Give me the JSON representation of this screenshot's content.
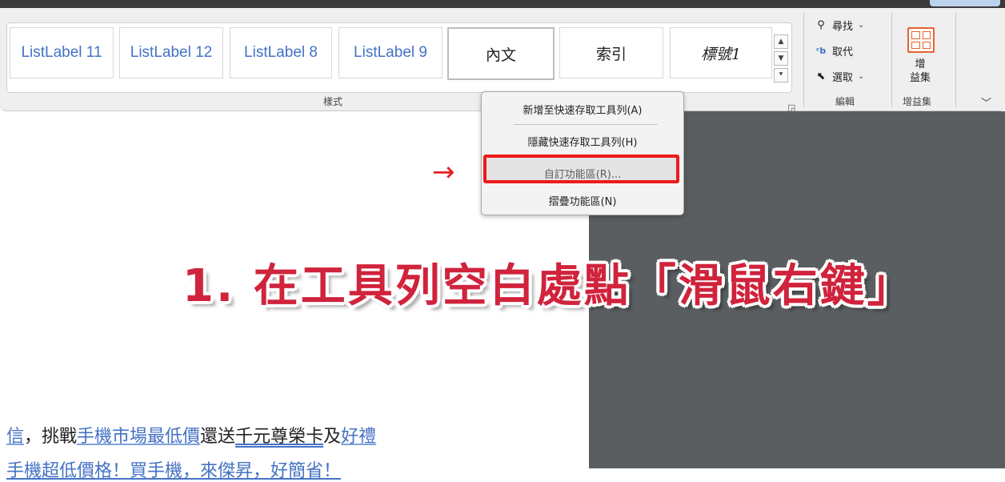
{
  "styles": {
    "items": [
      "ListLabel 11",
      "ListLabel 12",
      "ListLabel 8",
      "ListLabel 9",
      "內文",
      "索引",
      "標號1"
    ],
    "group_label": "樣式"
  },
  "editing": {
    "find": "尋找",
    "replace": "取代",
    "select": "選取",
    "group_label": "編輯"
  },
  "addins": {
    "button_label": "增\n益集",
    "group_label": "增益集"
  },
  "context_menu": {
    "items": [
      "新增至快速存取工具列(A)",
      "隱藏快速存取工具列(H)",
      "自訂功能區(R)...",
      "摺疊功能區(N)"
    ]
  },
  "annotation": {
    "caption": "1. 在工具列空白處點「滑鼠右鍵」",
    "arrow": "→",
    "highlight_color": "#ee1b1b"
  },
  "document": {
    "line1": {
      "a": "信",
      "b": "，挑戰",
      "c": "手機市場最低價",
      "d": "還送",
      "e": "千元尊榮卡",
      "f": "及",
      "g": "好禮"
    },
    "line2": "手機超低價格！買手機，來傑昇，好簡省！"
  },
  "colors": {
    "accent": "#4472c4",
    "caption": "#d0233c",
    "addin_icon": "#e8642c"
  }
}
